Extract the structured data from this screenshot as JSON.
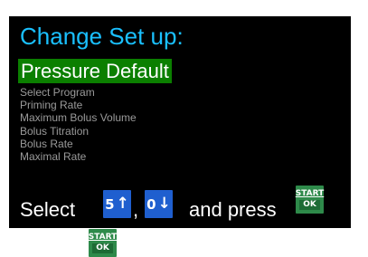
{
  "screen": {
    "title": "Change Set up:",
    "selected_item": "Pressure Default",
    "menu_items": [
      "Select Program",
      "Priming Rate",
      "Maximum Bolus Volume",
      "Bolus Titration",
      "Bolus Rate",
      "Maximal Rate"
    ],
    "instruction": {
      "prefix": "Select",
      "comma": ",",
      "suffix": "and press"
    }
  },
  "keys": {
    "up_key": {
      "digit": "5",
      "arrow": "↑"
    },
    "down_key": {
      "digit": "0",
      "arrow": "↓"
    },
    "start_ok": {
      "line1": "START",
      "line2": "OK"
    }
  },
  "colors": {
    "screen_bg": "#000000",
    "title": "#1ac0ff",
    "highlight_bg": "#0b7f00",
    "menu_text": "#9a9a9a",
    "key_blue": "#1f5fcf",
    "key_green": "#2e8a4a"
  }
}
